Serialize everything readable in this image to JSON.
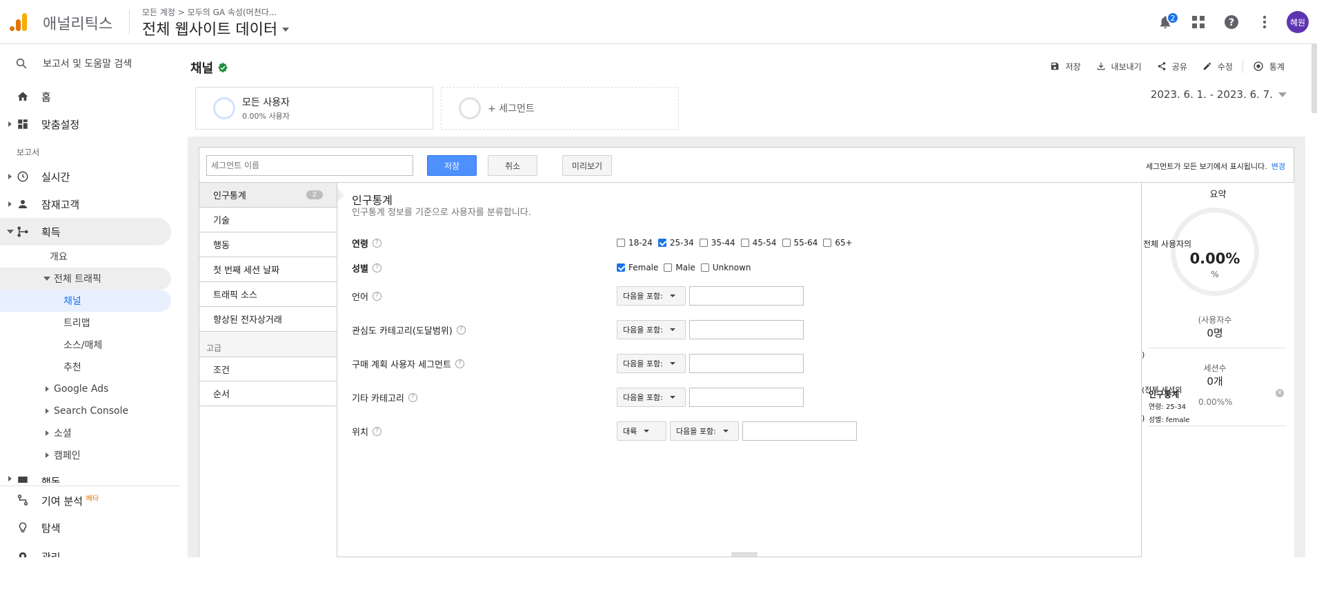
{
  "header": {
    "app_name": "애널리틱스",
    "breadcrumb": "모든 계정 > 모두의 GA 속성(머천다...",
    "property": "전체 웹사이트 데이터",
    "notification_count": "2",
    "avatar_text": "혜원"
  },
  "sidebar": {
    "search_label": "보고서 및 도움말 검색",
    "home": "홈",
    "customization": "맞춤설정",
    "reports_section": "보고서",
    "realtime": "실시간",
    "audience": "잠재고객",
    "acquisition": "획득",
    "overview": "개요",
    "all_traffic": "전체 트래픽",
    "channels": "채널",
    "treemap": "트리맵",
    "source_medium": "소스/매체",
    "referrals": "추천",
    "google_ads": "Google Ads",
    "search_console": "Search Console",
    "social": "소셜",
    "campaigns": "캠페인",
    "behavior": "행동",
    "attribution": "기여 분석",
    "beta": "베타",
    "discover": "탐색",
    "admin": "관리"
  },
  "report": {
    "title": "채널",
    "toolbar": {
      "save": "저장",
      "export": "내보내기",
      "share": "공유",
      "edit": "수정",
      "insights": "통계"
    },
    "segment_all_name": "모든 사용자",
    "segment_all_pct": "0.00% 사용자",
    "segment_add": "+ 세그먼트",
    "date_range": "2023. 6. 1. - 2023. 6. 7."
  },
  "editor": {
    "name_placeholder": "세그먼트 이름",
    "save": "저장",
    "cancel": "취소",
    "preview": "미리보기",
    "note": "세그먼트가 모든 보기에서 표시됩니다.",
    "note_link": "변경",
    "menu": {
      "demographics": "인구통계",
      "demographics_count": "2",
      "technology": "기술",
      "behavior": "행동",
      "first_session": "첫 번째 세션 날짜",
      "traffic_sources": "트래픽 소스",
      "ecommerce": "향상된 전자상거래",
      "advanced_label": "고급",
      "conditions": "조건",
      "sequences": "순서"
    },
    "body": {
      "title": "인구통계",
      "subtitle": "인구통계 정보를 기준으로 사용자를 분류합니다.",
      "age_label": "연령",
      "gender_label": "성별",
      "language_label": "언어",
      "interests_label": "관심도 카테고리(도달범위)",
      "inmarket_label": "구매 계획 사용자 세그먼트",
      "other_label": "기타 카테고리",
      "location_label": "위치",
      "ages": [
        "18-24",
        "25-34",
        "35-44",
        "45-54",
        "55-64",
        "65+"
      ],
      "age_checked": [
        false,
        true,
        false,
        false,
        false,
        false
      ],
      "genders": [
        "Female",
        "Male",
        "Unknown"
      ],
      "gender_checked": [
        true,
        false,
        false
      ],
      "contains": "다음을 포함:",
      "continent": "대륙"
    },
    "summary": {
      "title": "요약",
      "ring_label": "전체 사용자의",
      "ring_value": "0.00%",
      "ring_unit": "%",
      "users_label": "(사용자수",
      "users_value": "0명",
      "sessions_label": "세션수",
      "sessions_value": "0개",
      "paren_close": ")",
      "sessions_of_total": "(전체 세션의",
      "session_pct": "0.00%%",
      "filter_title": "인구통계",
      "filter_age": "연령: 25-34",
      "filter_gender": "성별: female"
    }
  },
  "colors": {
    "accent": "#1a73e8",
    "save_button": "#4d90fe",
    "verified": "#1e8e3e",
    "avatar": "#5e35b1",
    "logo_orange": "#f9ab00",
    "logo_dark_orange": "#e37400"
  }
}
